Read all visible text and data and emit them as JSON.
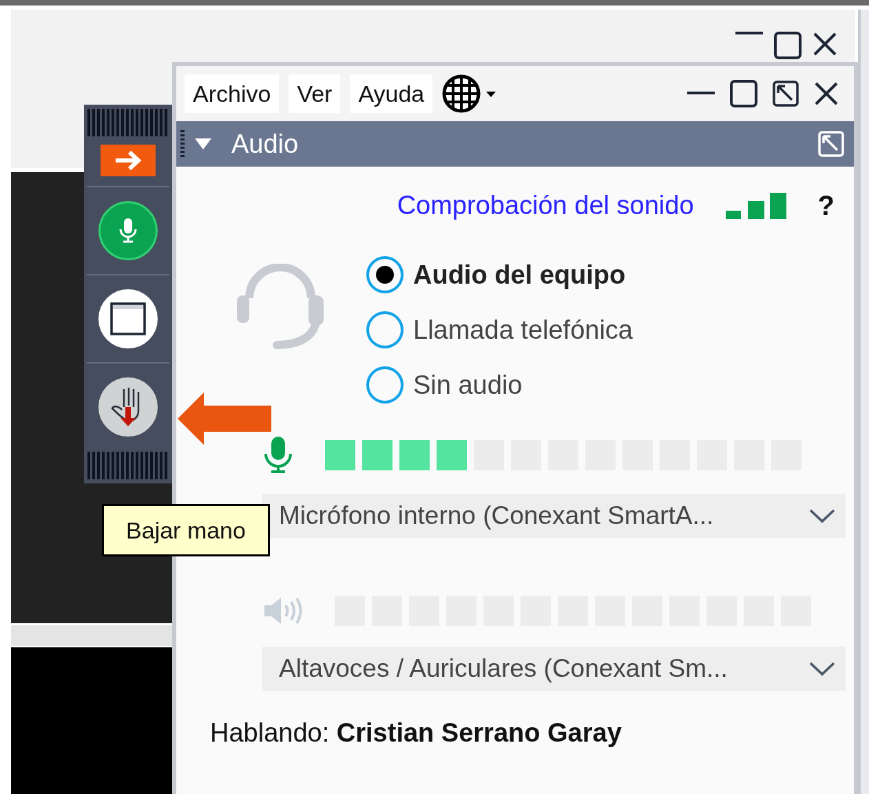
{
  "menu": [
    {
      "label": "Archivo"
    },
    {
      "label": "Ver"
    },
    {
      "label": "Ayuda"
    }
  ],
  "control_panel": {
    "mic_muted": false,
    "hand_raised": true
  },
  "audio_panel": {
    "title": "Audio",
    "expanded": true,
    "sound_check_link": "Comprobación del sonido",
    "help": "?",
    "options": [
      {
        "label": "Audio del equipo",
        "selected": true
      },
      {
        "label": "Llamada telefónica",
        "selected": false
      },
      {
        "label": "Sin audio",
        "selected": false
      }
    ],
    "microphone": {
      "level": 0.31,
      "device": "Micrófono interno (Conexant SmartA..."
    },
    "speakers": {
      "level": 0,
      "device": "Altavoces / Auriculares (Conexant Sm..."
    },
    "speaking": {
      "label": "Hablando:",
      "name": "Cristian Serrano Garay"
    }
  },
  "tooltip": "Bajar mano"
}
